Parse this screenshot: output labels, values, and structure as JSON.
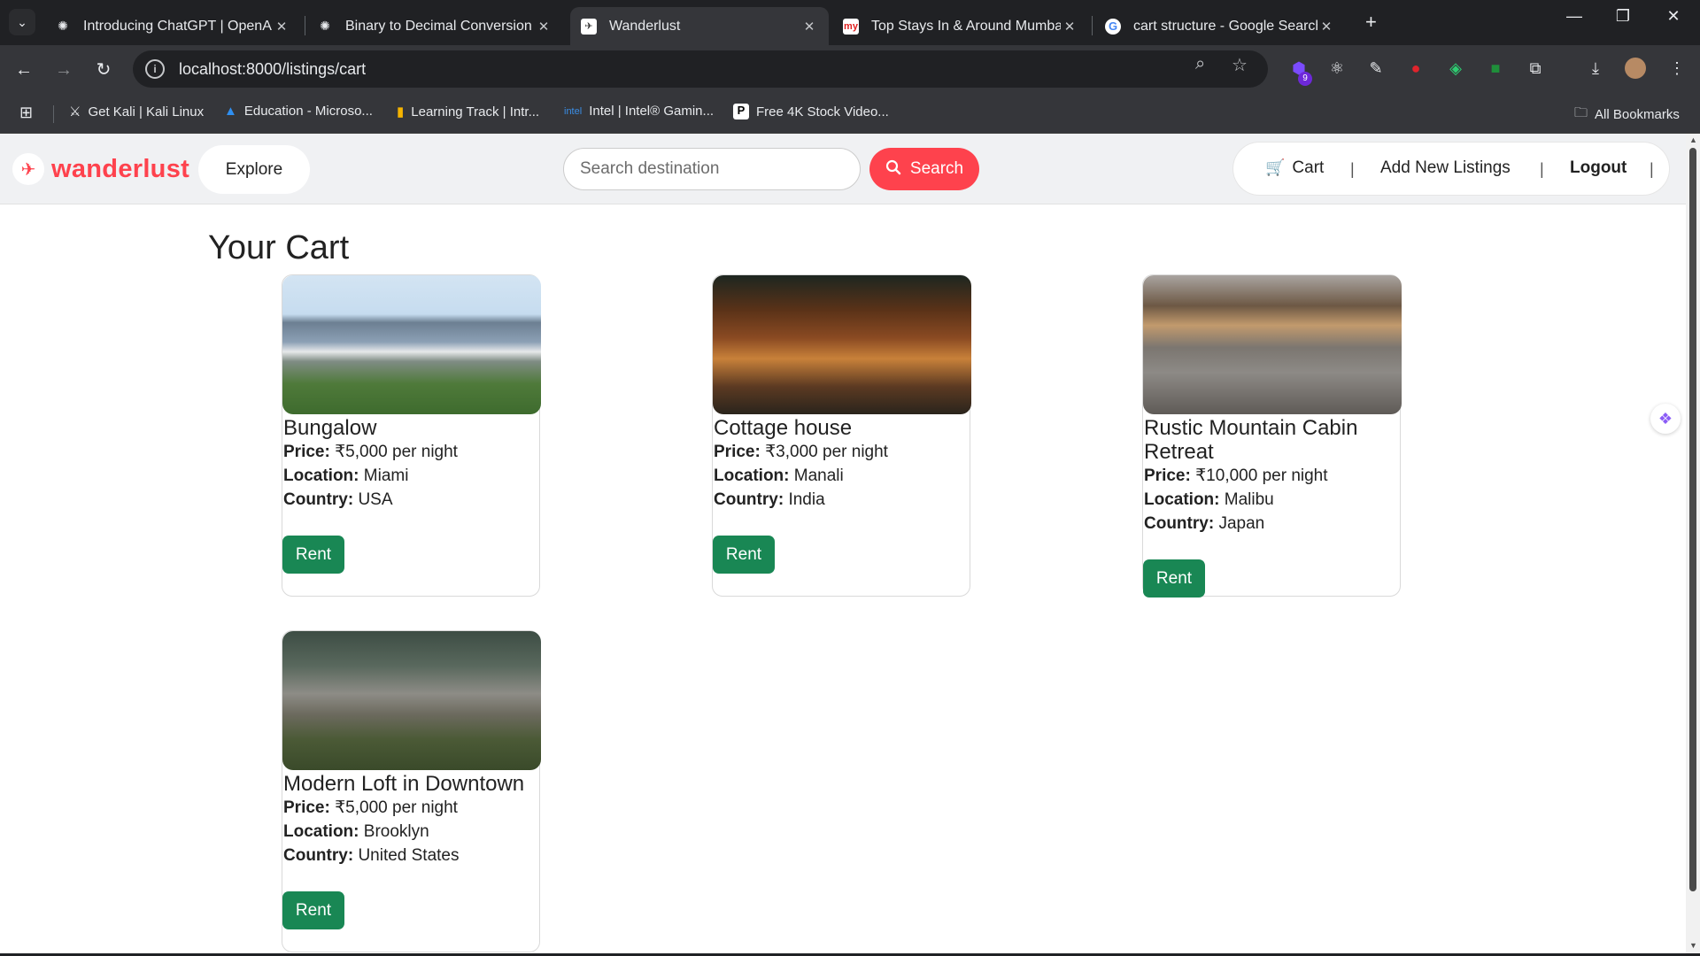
{
  "browser": {
    "tabs": [
      {
        "title": "Introducing ChatGPT | OpenAI",
        "icon": "openai-icon"
      },
      {
        "title": "Binary to Decimal Conversion",
        "icon": "openai-icon"
      },
      {
        "title": "Wanderlust",
        "icon": "airplane-icon",
        "active": true
      },
      {
        "title": "Top Stays In & Around Mumbai",
        "icon": "makemytrip-icon"
      },
      {
        "title": "cart structure - Google Search",
        "icon": "google-icon"
      }
    ],
    "address": "localhost:8000/listings/cart",
    "extension_badge": "9",
    "bookmarks": [
      {
        "label": "Get Kali | Kali Linux",
        "icon": "kali-icon"
      },
      {
        "label": "Education - Microso...",
        "icon": "azure-icon"
      },
      {
        "label": "Learning Track | Intr...",
        "icon": "chart-icon"
      },
      {
        "label": "Intel | Intel® Gamin...",
        "icon": "intel-icon"
      },
      {
        "label": "Free 4K Stock Video...",
        "icon": "pexels-icon"
      }
    ],
    "all_bookmarks": "All Bookmarks"
  },
  "site": {
    "brand": "wanderlust",
    "explore": "Explore",
    "search_placeholder": "Search destination",
    "search_button": "Search",
    "nav": {
      "cart": "Cart",
      "add": "Add New Listings",
      "logout": "Logout",
      "separator": "|"
    },
    "accent": "#fe424d",
    "rent_color": "#198754"
  },
  "cart": {
    "title": "Your Cart",
    "labels": {
      "price": "Price:",
      "location": "Location:",
      "country": "Country:"
    },
    "rent_label": "Rent",
    "listings": [
      {
        "name": "Bungalow",
        "price": "₹5,000 per night",
        "location": "Miami",
        "country": "USA"
      },
      {
        "name": "Cottage house",
        "price": "₹3,000 per night",
        "location": "Manali",
        "country": "India"
      },
      {
        "name": "Rustic Mountain Cabin Retreat",
        "price": "₹10,000 per night",
        "location": "Malibu",
        "country": "Japan"
      },
      {
        "name": "Modern Loft in Downtown",
        "price": "₹5,000 per night",
        "location": "Brooklyn",
        "country": "United States"
      }
    ]
  }
}
